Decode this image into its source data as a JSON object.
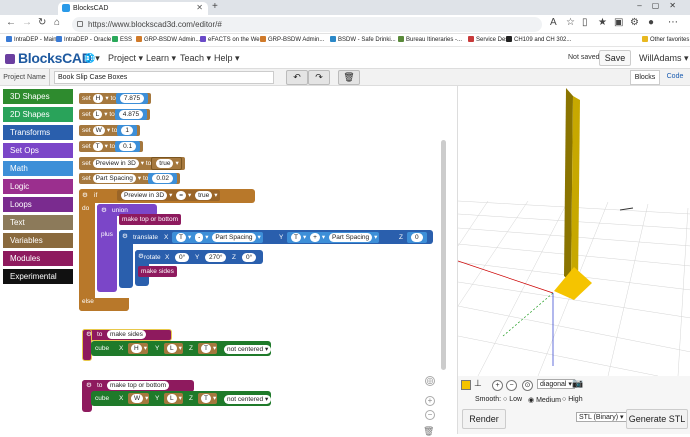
{
  "browser": {
    "tab_title": "BlocksCAD",
    "url": "https://www.blockscad3d.com/editor/#",
    "bookmarks": [
      "IntraDEP - Main",
      "IntraDEP - Oracle",
      "ESS",
      "GRP-BSDW Admin...",
      "eFACTS on the Web",
      "GRP-BSDW Admin...",
      "BSDW - Safe Drinki...",
      "Bureau Itineraries -...",
      "Service Desk",
      "CH109 and CH 302..."
    ],
    "other_favorites": "Other favorites"
  },
  "app": {
    "logo": "BlocksCAD",
    "menus": [
      "Project",
      "Learn",
      "Teach",
      "Help"
    ],
    "status": "Not saved",
    "save_label": "Save",
    "user": "WillAdams",
    "project_label": "Project Name",
    "project_name": "Book Slip Case Boxes",
    "view_tabs": [
      "Blocks",
      "Code"
    ]
  },
  "categories": [
    {
      "label": "3D Shapes",
      "color": "#2e8b2e"
    },
    {
      "label": "2D Shapes",
      "color": "#29a35a"
    },
    {
      "label": "Transforms",
      "color": "#2a5fad"
    },
    {
      "label": "Set Ops",
      "color": "#7b46c8"
    },
    {
      "label": "Math",
      "color": "#3d8fd8"
    },
    {
      "label": "Logic",
      "color": "#9b2f8e"
    },
    {
      "label": "Loops",
      "color": "#7a2b8f"
    },
    {
      "label": "Text",
      "color": "#8c7a5a"
    },
    {
      "label": "Variables",
      "color": "#8a6a3e"
    },
    {
      "label": "Modules",
      "color": "#8e1a5e"
    },
    {
      "label": "Experimental",
      "color": "#111111"
    }
  ],
  "blocks": {
    "set_kw": "set",
    "to_kw": "to",
    "vars": [
      {
        "name": "H",
        "value": "7.875"
      },
      {
        "name": "L",
        "value": "4.875"
      },
      {
        "name": "W",
        "value": "1"
      },
      {
        "name": "T",
        "value": "0.1"
      },
      {
        "name": "Preview in 3D",
        "value": "true"
      },
      {
        "name": "Part Spacing",
        "value": "0.02"
      }
    ],
    "if_kw": "if",
    "if_var": "Preview in 3D",
    "if_op": "=",
    "if_val": "true",
    "do_kw": "do",
    "else_kw": "else",
    "union_kw": "union",
    "plus_kw": "plus",
    "call_top": "make top or bottom",
    "translate_kw": "translate",
    "x_kw": "X",
    "y_kw": "Y",
    "z_kw": "Z",
    "tr_x1": "T",
    "tr_op1": "-",
    "tr_x2": "Part Spacing",
    "tr_y1": "T",
    "tr_op2": "+",
    "tr_y2": "Part Spacing",
    "tr_z": "0",
    "rotate_kw": "rotate",
    "rot_x": "0°",
    "rot_y": "270°",
    "rot_z": "0°",
    "call_sides": "make sides",
    "mod1_to": "to",
    "mod1_name": "make sides",
    "cube_kw": "cube",
    "mod1_x": "H",
    "mod1_y": "L",
    "mod1_z": "T",
    "centered": "not centered",
    "mod2_to": "to",
    "mod2_name": "make top or bottom",
    "mod2_x": "W",
    "mod2_y": "L",
    "mod2_z": "T"
  },
  "viewer": {
    "smooth_label": "Smooth:",
    "smooth_options": [
      "Low",
      "Medium",
      "High"
    ],
    "camera": "diagonal",
    "render_label": "Render",
    "export_format": "STL (Binary)",
    "generate_label": "Generate STL",
    "swatch_color": "#f5c400"
  }
}
